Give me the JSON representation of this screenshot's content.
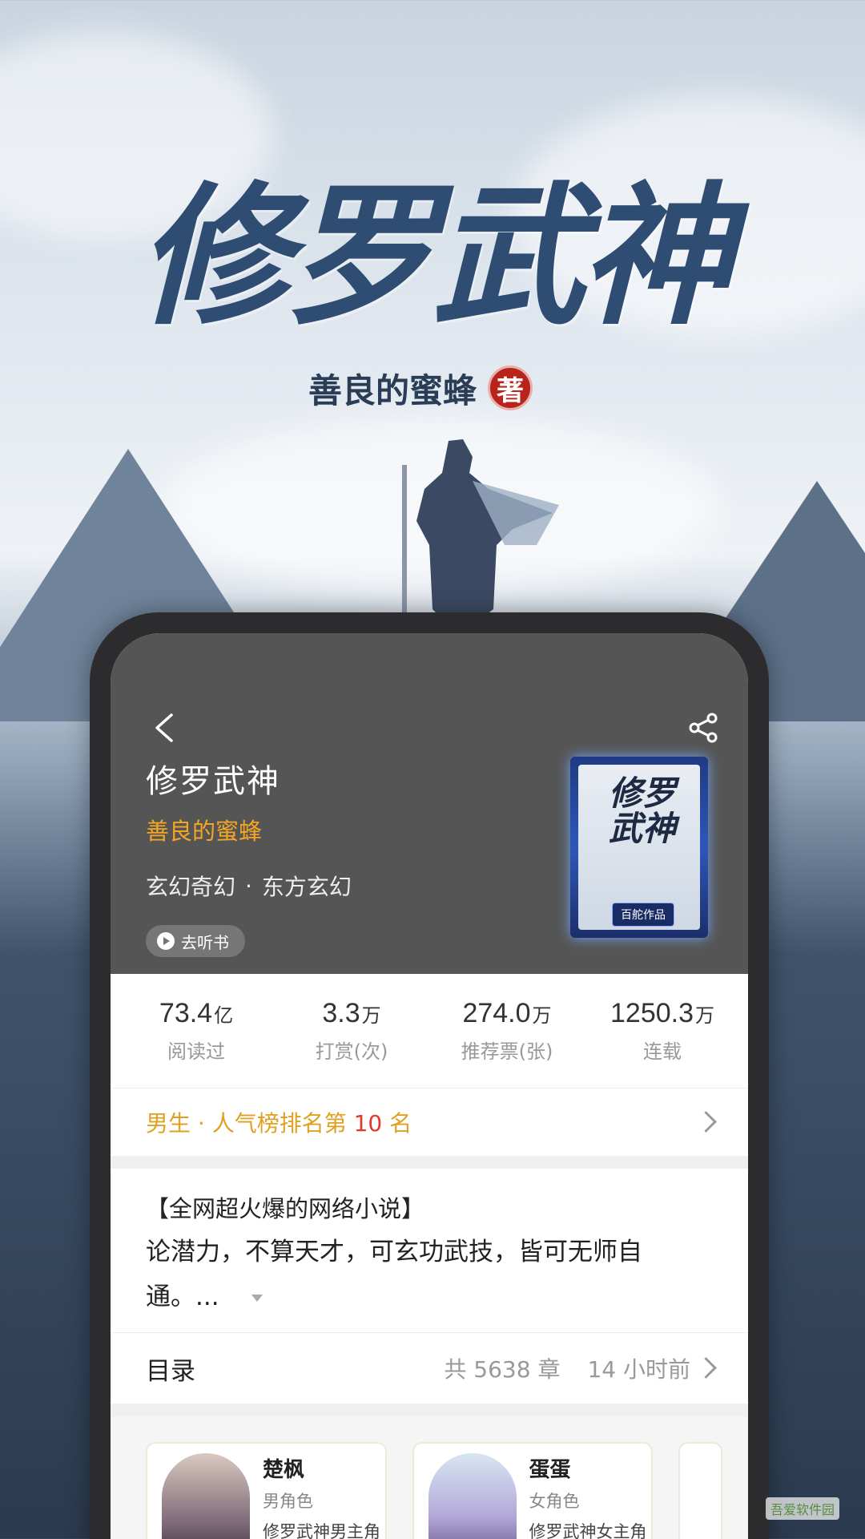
{
  "poster": {
    "title": "修罗武神",
    "author": "善良的蜜蜂",
    "seal": "著"
  },
  "book": {
    "title": "修罗武神",
    "author": "善良的蜜蜂",
    "genre_main": "玄幻奇幻",
    "genre_sep": "·",
    "genre_sub": "东方玄幻",
    "listen_label": "去听书",
    "cover_title": "修罗武神",
    "cover_badge": "百舵作品",
    "icons": {
      "back": "chevron-left-icon",
      "share": "share-icon",
      "play": "play-icon"
    }
  },
  "stats": [
    {
      "value": "73.4",
      "unit": "亿",
      "label": "阅读过"
    },
    {
      "value": "3.3",
      "unit": "万",
      "label": "打赏(次)"
    },
    {
      "value": "274.0",
      "unit": "万",
      "label": "推荐票(张)"
    },
    {
      "value": "1250.3",
      "unit": "万",
      "label": "连载"
    }
  ],
  "rank": {
    "prefix": "男生 · 人气榜排名第 ",
    "number": "10",
    "suffix": " 名"
  },
  "summary": {
    "headline": "【全网超火爆的网络小说】",
    "body": "论潜力，不算天才，可玄功武技，皆可无师自通。..."
  },
  "catalog": {
    "title": "目录",
    "count": "共 5638 章",
    "updated": "14 小时前"
  },
  "characters": [
    {
      "name": "楚枫",
      "role": "男角色",
      "desc": "修罗武神男主角"
    },
    {
      "name": "蛋蛋",
      "role": "女角色",
      "desc": "修罗武神女主角"
    }
  ],
  "colors": {
    "author": "#f5a623",
    "rank": "#e0a020",
    "rank_number": "#e23a2a",
    "header_bg": "#555555"
  },
  "watermark": "吾爱软件园"
}
